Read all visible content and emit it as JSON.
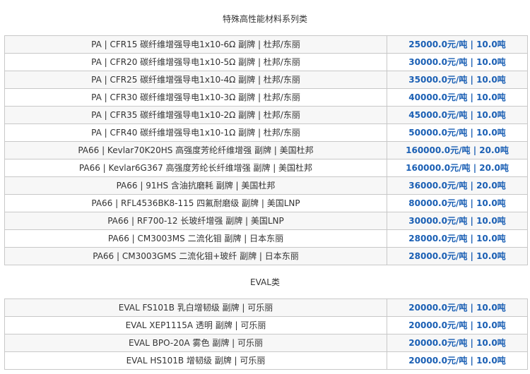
{
  "sections": [
    {
      "title": "特殊高性能材料系列类",
      "rows": [
        {
          "name": "PA | CFR15 碳纤维增强导电1x10-6Ω 副牌 | 杜邦/东丽",
          "price": "25000.0元/吨 | 10.0吨"
        },
        {
          "name": "PA | CFR20 碳纤维增强导电1x10-5Ω 副牌 | 杜邦/东丽",
          "price": "30000.0元/吨 | 10.0吨"
        },
        {
          "name": "PA | CFR25 碳纤维增强导电1x10-4Ω 副牌 | 杜邦/东丽",
          "price": "35000.0元/吨 | 10.0吨"
        },
        {
          "name": "PA | CFR30 碳纤维增强导电1x10-3Ω 副牌 | 杜邦/东丽",
          "price": "40000.0元/吨 | 10.0吨"
        },
        {
          "name": "PA | CFR35 碳纤维增强导电1x10-2Ω 副牌 | 杜邦/东丽",
          "price": "45000.0元/吨 | 10.0吨"
        },
        {
          "name": "PA | CFR40 碳纤维增强导电1x10-1Ω 副牌 | 杜邦/东丽",
          "price": "50000.0元/吨 | 10.0吨"
        },
        {
          "name": "PA66 | Kevlar70K20HS 高强度芳纶纤维增强 副牌 | 美国杜邦",
          "price": "160000.0元/吨 | 20.0吨"
        },
        {
          "name": "PA66 | Kevlar6G367 高强度芳纶长纤维增强 副牌 | 美国杜邦",
          "price": "160000.0元/吨 | 20.0吨"
        },
        {
          "name": "PA66 | 91HS 含油抗磨耗 副牌 | 美国杜邦",
          "price": "36000.0元/吨 | 20.0吨"
        },
        {
          "name": "PA66 | RFL4536BK8-115 四氟耐磨级 副牌 | 美国LNP",
          "price": "80000.0元/吨 | 10.0吨"
        },
        {
          "name": "PA66 | RF700-12 长玻纤增强 副牌 | 美国LNP",
          "price": "30000.0元/吨 | 10.0吨"
        },
        {
          "name": "PA66 | CM3003MS 二流化钼 副牌 | 日本东丽",
          "price": "28000.0元/吨 | 10.0吨"
        },
        {
          "name": "PA66 | CM3003GMS 二流化钼+玻纤 副牌 | 日本东丽",
          "price": "28000.0元/吨 | 10.0吨"
        }
      ]
    },
    {
      "title": "EVAL类",
      "rows": [
        {
          "name": "EVAL FS101B 乳白增韧级 副牌 | 可乐丽",
          "price": "20000.0元/吨 | 10.0吨"
        },
        {
          "name": "EVAL XEP1115A 透明 副牌 | 可乐丽",
          "price": "20000.0元/吨 | 10.0吨"
        },
        {
          "name": "EVAL BPO-20A 雾色 副牌 | 可乐丽",
          "price": "20000.0元/吨 | 10.0吨"
        },
        {
          "name": "EVAL HS101B 增韧级 副牌 | 可乐丽",
          "price": "20000.0元/吨 | 10.0吨"
        }
      ]
    }
  ],
  "colors": {
    "price_text": "#1a5fb4",
    "border": "#c8c8c8",
    "row_alt": "#f7f7f7"
  }
}
